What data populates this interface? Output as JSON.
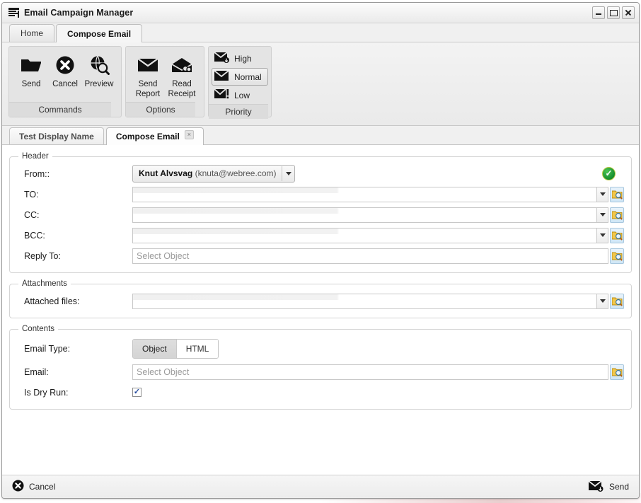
{
  "window": {
    "title": "Email Campaign Manager",
    "icon": "list-window-icon",
    "controls": [
      {
        "name": "minimize-button",
        "glyph": "minimize-icon"
      },
      {
        "name": "maximize-button",
        "glyph": "maximize-icon"
      },
      {
        "name": "close-button",
        "glyph": "close-icon"
      }
    ]
  },
  "ribbon": {
    "tabs": [
      {
        "label": "Home",
        "active": false
      },
      {
        "label": "Compose Email",
        "active": true
      }
    ],
    "groups": [
      {
        "title": "Commands",
        "buttons": [
          {
            "label": "Send",
            "icon": "folder-open-icon"
          },
          {
            "label": "Cancel",
            "icon": "cancel-circle-icon"
          },
          {
            "label": "Preview",
            "icon": "globe-search-icon"
          }
        ]
      },
      {
        "title": "Options",
        "buttons": [
          {
            "label": "Send\nReport",
            "line1": "Send",
            "line2": "Report",
            "icon": "envelope-icon"
          },
          {
            "label": "Read\nReceipt",
            "line1": "Read",
            "line2": "Receipt",
            "icon": "envelope-open-gear-icon"
          }
        ]
      },
      {
        "title": "Priority",
        "items": [
          {
            "label": "High",
            "icon": "envelope-high-icon",
            "selected": false
          },
          {
            "label": "Normal",
            "icon": "envelope-normal-icon",
            "selected": true
          },
          {
            "label": "Low",
            "icon": "envelope-low-icon",
            "selected": false
          }
        ]
      }
    ]
  },
  "doc_tabs": [
    {
      "label": "Test Display Name",
      "active": false,
      "closable": false
    },
    {
      "label": "Compose Email",
      "active": true,
      "closable": true,
      "close_glyph": "×"
    }
  ],
  "sections": {
    "header": {
      "legend": "Header",
      "from": {
        "label": "From::",
        "name_part": "Knut Alvsvag",
        "email_part": "(knuta@webree.com)",
        "status_icon": "valid-check-icon"
      },
      "fields": [
        {
          "label": "TO:",
          "value": "",
          "placeholder": "",
          "has_dropdown": true,
          "has_browse": true
        },
        {
          "label": "CC:",
          "value": "",
          "placeholder": "",
          "has_dropdown": true,
          "has_browse": true
        },
        {
          "label": "BCC:",
          "value": "",
          "placeholder": "",
          "has_dropdown": true,
          "has_browse": true
        },
        {
          "label": "Reply To:",
          "value": "",
          "placeholder": "Select Object",
          "has_dropdown": false,
          "has_browse": true
        }
      ]
    },
    "attachments": {
      "legend": "Attachments",
      "fields": [
        {
          "label": "Attached files:",
          "value": "",
          "placeholder": "",
          "has_dropdown": true,
          "has_browse": true
        }
      ]
    },
    "contents": {
      "legend": "Contents",
      "email_type": {
        "label": "Email Type:",
        "options": [
          {
            "label": "Object",
            "selected": true
          },
          {
            "label": "HTML",
            "selected": false
          }
        ]
      },
      "email": {
        "label": "Email:",
        "value": "",
        "placeholder": "Select Object",
        "has_browse": true
      },
      "dry_run": {
        "label": "Is Dry Run:",
        "checked": true,
        "check_glyph": "✓"
      }
    }
  },
  "footer": {
    "cancel": {
      "label": "Cancel",
      "icon": "cancel-circle-icon"
    },
    "send": {
      "label": "Send",
      "icon": "envelope-send-icon"
    }
  },
  "colors": {
    "accent_green": "#128a2b",
    "browse_blue": "#cfe6f6",
    "check_blue": "#2b4fa0"
  }
}
